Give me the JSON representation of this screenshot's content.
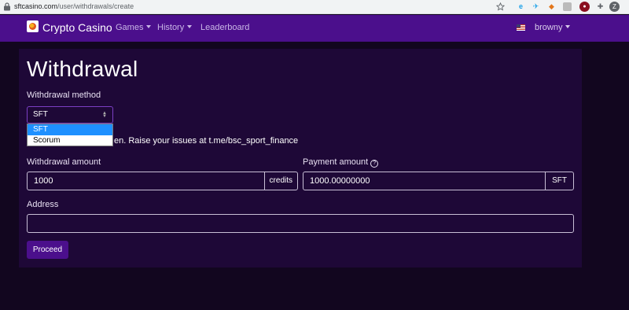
{
  "browser": {
    "url_host": "sftcasino.com",
    "url_path": "/user/withdrawals/create",
    "profile_initial": "Z"
  },
  "navbar": {
    "brand": "Crypto Casino",
    "games": "Games",
    "history": "History",
    "leaderboard": "Leaderboard",
    "user": "browny"
  },
  "page": {
    "title": "Withdrawal",
    "method_label": "Withdrawal method",
    "method_selected": "SFT",
    "method_options": [
      "SFT",
      "Scorum"
    ],
    "help_text": "en. Raise your issues at t.me/bsc_sport_finance",
    "amount_label": "Withdrawal amount",
    "amount_value": "1000",
    "amount_unit": "credits",
    "payment_label": "Payment amount",
    "payment_value": "1000.00000000",
    "payment_unit": "SFT",
    "address_label": "Address",
    "address_value": "",
    "proceed": "Proceed"
  },
  "colors": {
    "navbar": "#4b0f8c",
    "card": "#1e0837",
    "background": "#12061f",
    "dropdown_selected": "#1e90ff"
  }
}
